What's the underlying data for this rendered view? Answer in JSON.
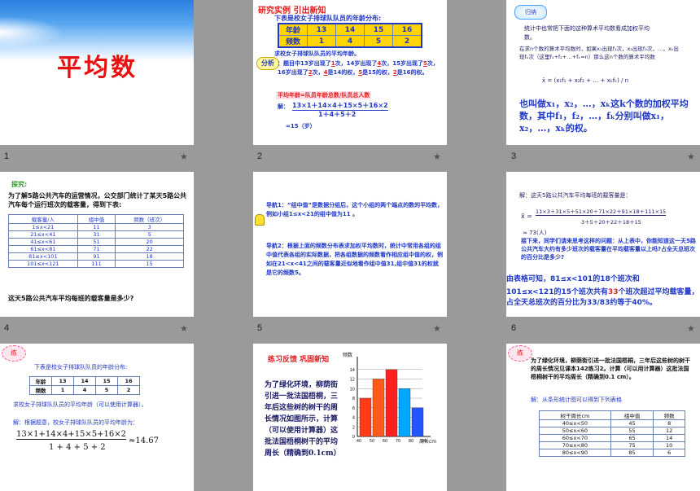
{
  "grid": {
    "numbers": [
      "1",
      "2",
      "3",
      "4",
      "5",
      "6"
    ],
    "star": "★"
  },
  "s1": {
    "title": "平均数"
  },
  "s2": {
    "heading": "研究实例  引出新知",
    "intro": "下表是校女子排球队队员的年龄分布:",
    "row1": [
      "年龄",
      "13",
      "14",
      "15",
      "16"
    ],
    "row2": [
      "频数",
      "1",
      "4",
      "5",
      "2"
    ],
    "ask": "求校女子排球队队员的平均年龄。",
    "badge": "分析",
    "a1": "：题目中13岁出现了",
    "a1v": "1",
    "a2": "次，14岁出现了",
    "a2v": "4",
    "a3": "次，15岁出现了",
    "a3v": "5",
    "a4": "次，16岁出现了",
    "a4v": "2",
    "a5": "次，",
    "a5v": "4",
    "a6": "是14的权，",
    "a6v": "5",
    "a7": "是15的权，",
    "a7v": "2",
    "a8": "是16的权。",
    "formula_label": "平均年龄=队员年龄总数/队员总人数",
    "jie": "解：",
    "numer": "13×1＋14×4＋15×5＋16×2",
    "denom": "1＋4＋5＋2",
    "approx": "≈15（岁）"
  },
  "s3": {
    "badge": "归纳",
    "p1": "统计中也常把下面的这种算术平均数看成加权平均数。",
    "p2": "在求n个数的算术平均数时，如果x₁出现f₁次，x₂出现f₂次，…，xₖ出现fₖ次（这里f₁+f₂+…+fₖ=n）那么这n个数的算术平均数",
    "formula": "x̄ = (x₁f₁ + x₂f₂ + … + xₖfₖ) / n",
    "p3": "也叫做x₁，x₂，…，xₖ这k个数的加权平均数，其中f₁，f₂，…，fₖ分别叫做x₁，x₂，…，xₖ的权。"
  },
  "s4": {
    "label": "探究:",
    "p1": "为了解5路公共汽车的运营情况，公交部门统计了某天5路公共汽车每个运行班次的载客量，得到下表:",
    "headers": [
      "载客量/人",
      "组中值",
      "频数（班次）"
    ],
    "rows": [
      [
        "1≤x<21",
        "11",
        "3"
      ],
      [
        "21≤x<41",
        "31",
        "5"
      ],
      [
        "41≤x<61",
        "51",
        "20"
      ],
      [
        "61≤x<81",
        "71",
        "22"
      ],
      [
        "81≤x<101",
        "91",
        "18"
      ],
      [
        "101≤x<121",
        "111",
        "15"
      ]
    ],
    "q": "这天5路公共汽车平均每班的载客量是多少?"
  },
  "s5": {
    "t1": "导航1：“组中值”是数据分组后，这个小组的两个端点的数的平均数，例如小组1≤x<21的组中值为11 。",
    "t2": "导航2：根据上面的频数分布表求加权平均数时，统计中常用各组的组中值代表各组的实际数据，把各组数据的频数看作相应组中值的权，例如在21<x<41之间的载客量近似地看作组中值31,组中值31的权就是它的频数5。"
  },
  "s6": {
    "p1": "解：这天5路公共汽车平均每班的载客量是：",
    "numer": "11×3＋31×5＋51×20＋71×22＋91×18＋111×15",
    "denom": "3＋5＋20＋22＋18＋15",
    "approx": "≈ 73(人)",
    "p2": "接下来，同学们请来思考这样的问题：从上表中，你能知道这一天5路公共汽车大约有多少班次的载客量在平均载客量以上吗?占全天总班次的百分比是多少?",
    "b1": "由表格可知，81≤x<101的18个班次和",
    "b2": "101≤x<121的15个班次共有",
    "b2r": "33",
    "b3": "个班次超过平均载客量，占全天总班次的百分比为33/83约等于40%。"
  },
  "s7": {
    "badge": "练",
    "intro": "下表是校女子排球队队员的年龄分布:",
    "row1": [
      "年龄",
      "13",
      "14",
      "15",
      "16"
    ],
    "row2": [
      "频数",
      "1",
      "4",
      "5",
      "2"
    ],
    "ask": "求校女子排球队队员的平均年龄（可以使用计算器）。",
    "jie": "解：根据题意，校女子排球队队员的平均年龄为：",
    "numer": "13×1+14×4+15×5+16×2",
    "denom": "1 + 4 + 5 + 2",
    "approx": "≈14.67"
  },
  "s8": {
    "heading": "练习反馈  巩固新知",
    "text": "为了绿化环境，柳荫街引进一批法国梧桐，三年后这些树的树干的周长情况如图所示，计算（可以使用计算器）这批法国梧桐树干的平均周长（精确到0.1cm）",
    "ylabel": "频数",
    "xlabel": "周长cm"
  },
  "chart_data": {
    "type": "bar",
    "categories": [
      "40",
      "50",
      "60",
      "70",
      "80",
      "90"
    ],
    "values": [
      8,
      12,
      14,
      10,
      6
    ],
    "yticks": [
      "0",
      "2",
      "4",
      "6",
      "8",
      "10",
      "12",
      "14"
    ],
    "ylim": [
      0,
      16
    ],
    "xlabel": "周长cm",
    "ylabel": "频数",
    "colors": [
      "#ff3b1a",
      "#ff5a1a",
      "#ff2020",
      "#00a8ff",
      "#2255ff"
    ]
  },
  "s9": {
    "badge": "练",
    "p1": "为了绿化环境，柳荫街引进一批法国梧桐，三年后这些树的树干的周长情况见课本142练习2。计算（可以用计算器）这批法国梧桐树干的平均周长（精确到0.1 cm）。",
    "jie": "解：从条形统计图可以得到下列表格",
    "headers": [
      "树干周长cm",
      "组中值",
      "频数"
    ],
    "rows": [
      [
        "40≤x<50",
        "45",
        "8"
      ],
      [
        "50≤x<60",
        "55",
        "12"
      ],
      [
        "60≤x<70",
        "65",
        "14"
      ],
      [
        "70≤x<80",
        "75",
        "10"
      ],
      [
        "80≤x<90",
        "85",
        "6"
      ]
    ]
  }
}
